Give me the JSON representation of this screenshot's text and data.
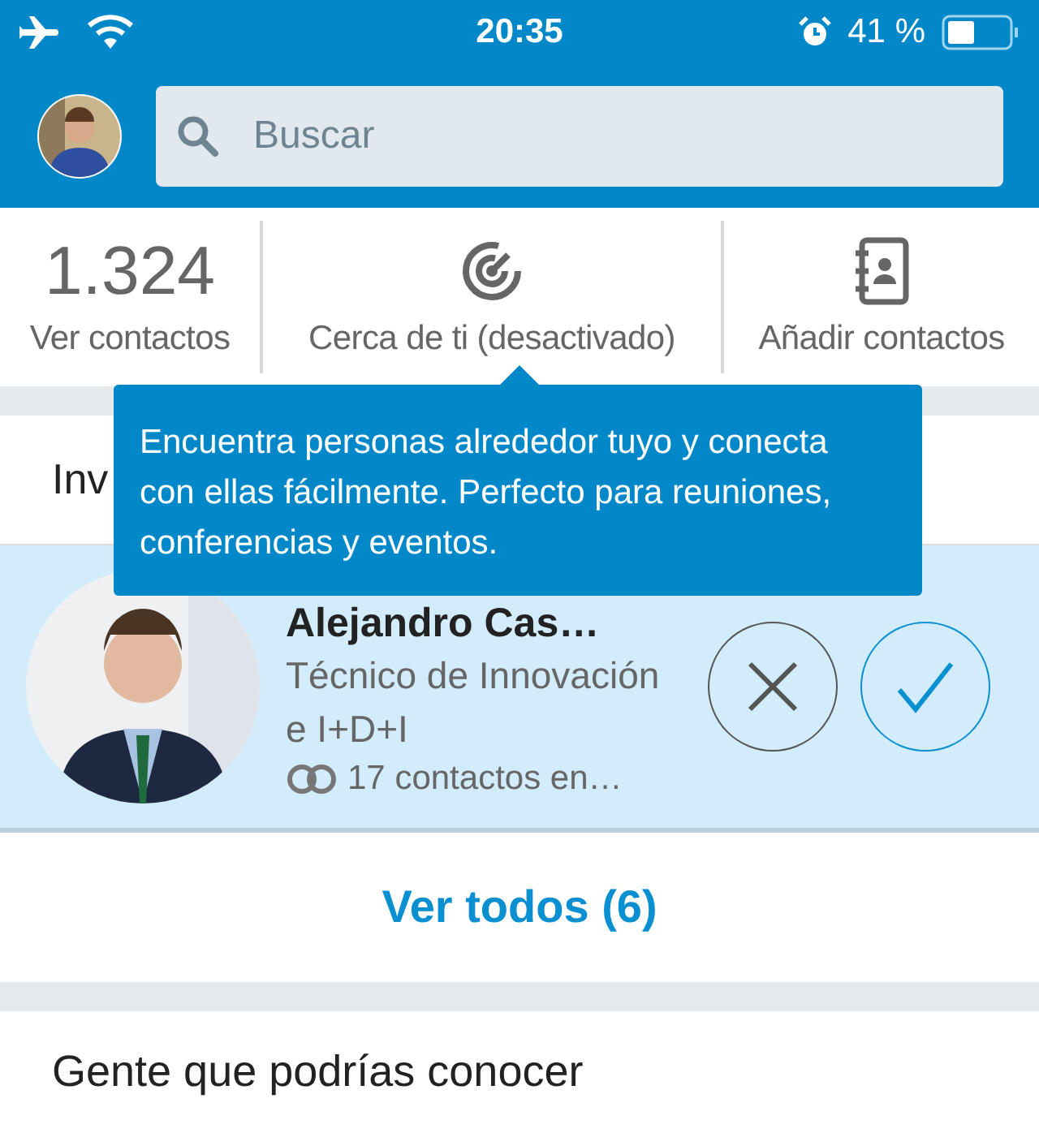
{
  "status_bar": {
    "time": "20:35",
    "battery": "41 %"
  },
  "search": {
    "placeholder": "Buscar"
  },
  "stats": [
    {
      "kind": "count",
      "value": "1.324",
      "label": "Ver contactos"
    },
    {
      "kind": "nearby",
      "label": "Cerca de ti (desactivado)"
    },
    {
      "kind": "add",
      "label": "Añadir contactos"
    }
  ],
  "tooltip": {
    "text": "Encuentra personas alrededor tuyo y conecta con ellas fácilmente. Perfecto para reuniones, conferencias y eventos."
  },
  "invitations": {
    "title": "Inv",
    "items": [
      {
        "name": "Alejandro Cas…",
        "headline": "Técnico de Innovación e I+D+I",
        "shared": "17 contactos en…"
      }
    ],
    "see_all": "Ver todos (6)"
  },
  "suggestions": {
    "title": "Gente que podrías conocer"
  }
}
